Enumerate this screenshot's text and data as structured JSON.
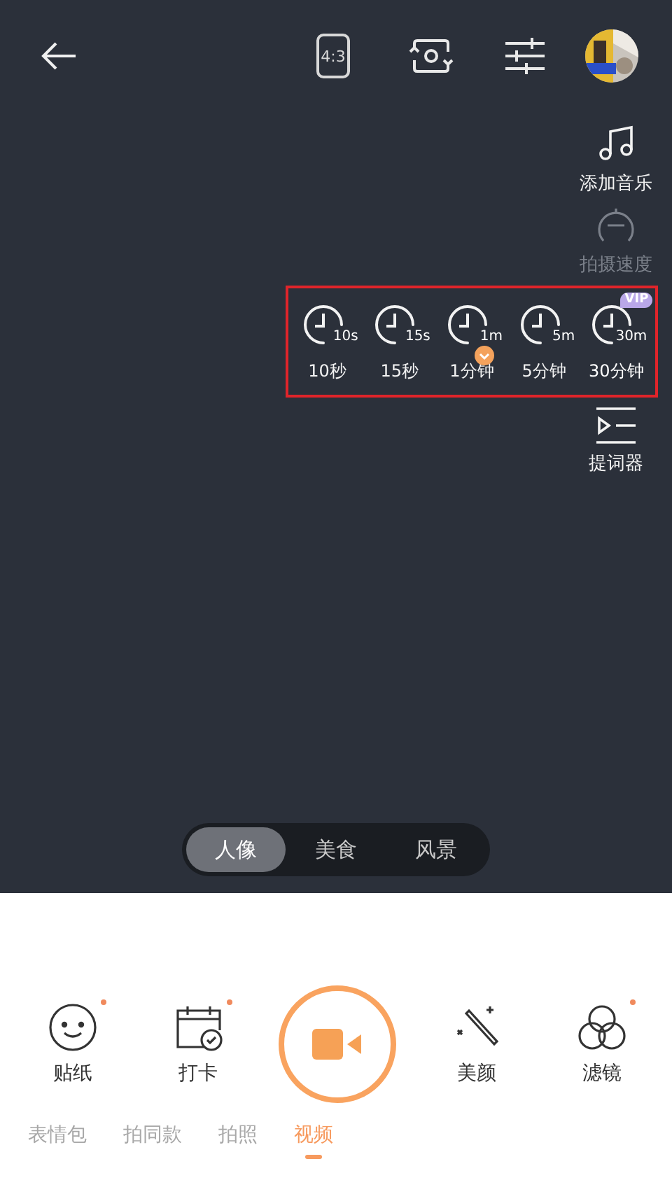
{
  "top_bar": {
    "aspect_ratio": "4:3"
  },
  "side_tools": [
    {
      "label": "添加音乐",
      "disabled": false
    },
    {
      "label": "拍摄速度",
      "disabled": true
    }
  ],
  "timers": [
    {
      "badge": "10s",
      "label": "10秒",
      "selected": false,
      "vip": false
    },
    {
      "badge": "15s",
      "label": "15秒",
      "selected": false,
      "vip": false
    },
    {
      "badge": "1m",
      "label": "1分钟",
      "selected": true,
      "vip": false
    },
    {
      "badge": "5m",
      "label": "5分钟",
      "selected": false,
      "vip": false
    },
    {
      "badge": "30m",
      "label": "30分钟",
      "selected": false,
      "vip": true,
      "vip_text": "VIP"
    }
  ],
  "teleprompter": {
    "label": "提词器"
  },
  "scenes": [
    {
      "label": "人像",
      "selected": true
    },
    {
      "label": "美食",
      "selected": false
    },
    {
      "label": "风景",
      "selected": false
    }
  ],
  "tools": [
    {
      "label": "贴纸",
      "dot": true
    },
    {
      "label": "打卡",
      "dot": true
    },
    {
      "label": "美颜",
      "dot": false
    },
    {
      "label": "滤镜",
      "dot": true
    }
  ],
  "modes": [
    {
      "label": "表情包",
      "selected": false
    },
    {
      "label": "拍同款",
      "selected": false
    },
    {
      "label": "拍照",
      "selected": false
    },
    {
      "label": "视频",
      "selected": true
    }
  ]
}
